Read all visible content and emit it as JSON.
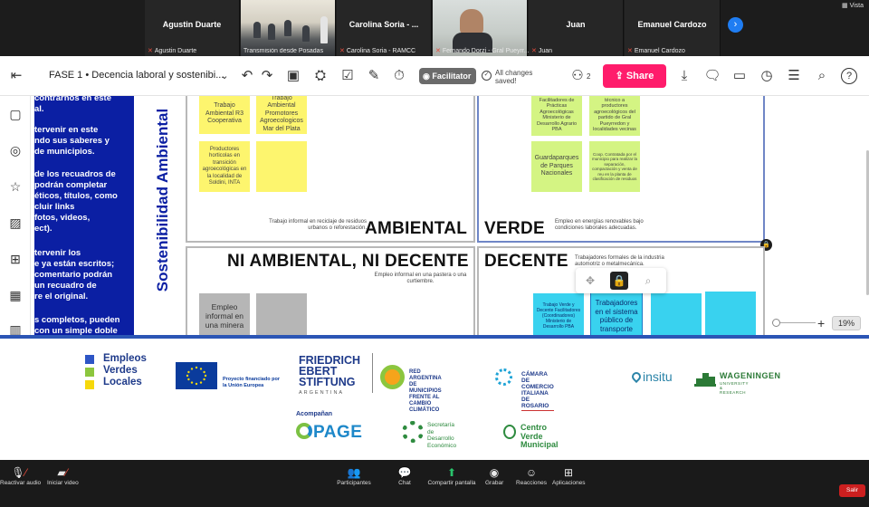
{
  "participants": {
    "tiles": [
      {
        "name": "Agustin Duarte",
        "label": "Agustin Duarte"
      },
      {
        "name": "",
        "label": "Transmisión desde Posadas"
      },
      {
        "name": "Carolina Soria - ...",
        "label": "Carolina Soria - RAMCC"
      },
      {
        "name": "",
        "label": "Fernando Dorzi - Gral Pueyrr..."
      },
      {
        "name": "Juan",
        "label": "Juan"
      },
      {
        "name": "Emanuel Cardozo",
        "label": "Emanuel Cardozo"
      }
    ],
    "view_label": "Vista"
  },
  "toolbar": {
    "board_title": "FASE 1 • Decencia laboral y sostenibi...",
    "facilitator_label": "Facilitator",
    "saved_status": "All changes saved!",
    "members_count": "2",
    "share_label": "Share"
  },
  "board": {
    "left_panel_lines": [
      "contrarnos en este",
      "al.",
      "tervenir en este",
      "ndo sus saberes y",
      "de municipios.",
      "",
      "de los recuadros de",
      "podrán completar",
      "éticos, títulos, como",
      "cluir links",
      "fotos, videos,",
      "ect).",
      "",
      "tervenir los",
      "e ya están escritos;",
      "comentario podrán",
      "un recuadro de",
      "re el original.",
      "",
      "s completos, pueden",
      "con un simple doble"
    ],
    "vertical_label": "Sostenibilidad Ambiental",
    "quadrants": {
      "ambiental": {
        "title": "AMBIENTAL",
        "desc": "Trabajo informal en reciclaje de residuos urbanos o reforestación."
      },
      "verde": {
        "title": "VERDE",
        "desc": "Empleo en energías renovables bajo condiciones laborales adecuadas."
      },
      "ni": {
        "title": "NI AMBIENTAL, NI DECENTE",
        "desc": "Empleo informal en una pastera o una curtiembre."
      },
      "decente": {
        "title": "DECENTE",
        "desc": "Trabajadores formales de la industria automotriz o metalmecánica."
      }
    },
    "notes": {
      "n1": "Trabajo Ambiental R3 Cooperativa",
      "n2": "Trabajo Ambiental Promotores Agroecologicos Mar del Plata",
      "n3": "Productores horticolas en transición agroecológicas en la localidad de Soldini, INTA",
      "g1": "Facilitadores de Prácticas Agroecológicas Ministerio de Desarrollo Agrario PBA",
      "g2": "técnico a productores agroecológicos del partido de Gral Pueyrredon y localidades vecinas",
      "g3": "Guardaparques de Parques Nacionales",
      "g4": "Coop. Contratada por el municipio para realizar la separación, compactación y venta de reu en la planta de clasificación de residuos",
      "gr1": "Empleo informal en una minera",
      "c1": "Trabajo Verde y Decente Facilitadores (Coordinadores) Ministerio de Desarrollo PBA",
      "c2": "Trabajadores en el sistema público de transporte"
    },
    "zoom": {
      "percent": "19%"
    }
  },
  "logos": {
    "evl": [
      "Empleos",
      "Verdes",
      "Locales"
    ],
    "eu_text": [
      "Proyecto financiado por",
      "la Unión Europea"
    ],
    "fes": [
      "FRIEDRICH",
      "EBERT",
      "STIFTUNG",
      "ARGENTINA"
    ],
    "red": [
      "RED ARGENTINA DE",
      "MUNICIPIOS FRENTE AL",
      "CAMBIO CLIMÁTICO"
    ],
    "camara": [
      "CÁMARA DE COMERCIO ITALIANA",
      "DE ROSARIO"
    ],
    "insitu": "insitu",
    "wag": [
      "WAGENINGEN",
      "UNIVERSITY & RESEARCH"
    ],
    "acompanan": "Acompañan",
    "page": "PAGE",
    "sde": [
      "Secretaría de",
      "Desarrollo",
      "Económico"
    ],
    "cvm": [
      "Centro Verde",
      "Municipal"
    ]
  },
  "controls": {
    "audio": "Reactivar audio",
    "video": "Iniciar video",
    "participants": "Participantes",
    "chat": "Chat",
    "share_screen": "Compartir pantalla",
    "record": "Grabar",
    "reactions": "Reacciones",
    "apps": "Aplicaciones",
    "leave": "Salir"
  },
  "colors": {
    "share_button": "#ff1c6b",
    "panel_blue": "#0b1fa3",
    "sticky_yellow": "#fdf56e",
    "sticky_green": "#d4f483",
    "sticky_cyan": "#39d2ef",
    "leave_red": "#cc1f1f"
  }
}
